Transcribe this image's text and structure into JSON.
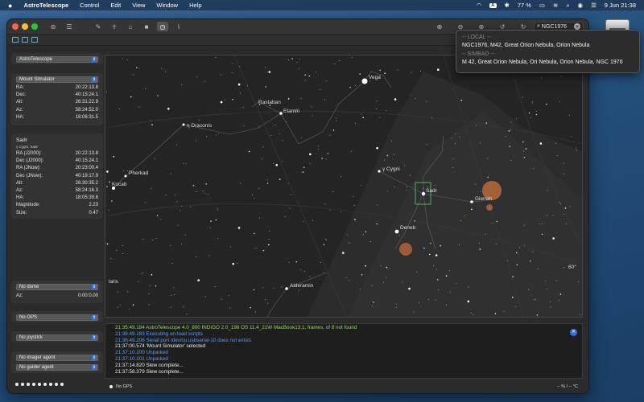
{
  "menubar": {
    "app_name": "AstroTelescope",
    "menus": [
      "Control",
      "Edit",
      "View",
      "Window",
      "Help"
    ],
    "input_badge": "A",
    "battery": "77 %",
    "datetime": "9 Jun  21:38"
  },
  "toolbar": {
    "search_value": "NGC1976"
  },
  "search_popup": {
    "local_header": "-- LOCAL --",
    "local_result": "NGC1976, M42, Great Orion Nebula, Orion Nebula",
    "simbad_header": "-- SIMBAD --",
    "simbad_result": "M  42, Great Orion Nebula, Ori Nebula, Orion Nebula, NGC  1976"
  },
  "sidebar": {
    "app_select": "AstroTelescope",
    "mount_select": "Mount Simulator",
    "mount": [
      {
        "k": "RA:",
        "v": "20:22:13.8"
      },
      {
        "k": "Dec:",
        "v": "40:15:24.1"
      },
      {
        "k": "Alt:",
        "v": "26:31:22.9"
      },
      {
        "k": "Az:",
        "v": "58:24:52.0"
      },
      {
        "k": "HA:",
        "v": "18:06:31.5"
      }
    ],
    "object_name": "Sadr",
    "object_sub": "γ Cygni, Sadr",
    "object": [
      {
        "k": "RA (J2000):",
        "v": "20:22:13.8"
      },
      {
        "k": "Dec (J2000):",
        "v": "40:15:24.1"
      },
      {
        "k": "RA (JNow):",
        "v": "20:23:00.4"
      },
      {
        "k": "Dec (JNow):",
        "v": "40:19:17.9"
      },
      {
        "k": "Alt:",
        "v": "26:30:35.2"
      },
      {
        "k": "Az:",
        "v": "58:24:16.3"
      },
      {
        "k": "HA:",
        "v": "18:05:39.8"
      },
      {
        "k": "Magnitude:",
        "v": "2.23"
      },
      {
        "k": "Size:",
        "v": "0.47"
      }
    ],
    "dome_select": "No dome",
    "dome_az_label": "Az:",
    "dome_az_value": "0:00:0.00",
    "gps_select": "No GPS",
    "joystick_select": "No joystick",
    "imager_select": "No imager agent",
    "guider_select": "No guider agent"
  },
  "skymap": {
    "labels": [
      "Vega",
      "Rastaban",
      "Etamin",
      "η Draconis",
      "Pherkad",
      "Kocab",
      "γ Cygni",
      "Sadr",
      "Gienah",
      "Deneb",
      "Alderamin",
      "60°",
      "laris"
    ]
  },
  "log": {
    "lines": [
      {
        "t": "21:35:49.184 AstroTelescope 4.0_800 INDIGO 2.0_198 OS 11.4_21W MacBook13,1, frames, of 8 not found",
        "c": "green"
      },
      {
        "t": "21:36:49.183 Executing on-load scripts",
        "c": "blue"
      },
      {
        "t": "21:36:49.208 Serial port /dev/cu.usbserial-10 does not exists",
        "c": "blue"
      },
      {
        "t": "21:37:00.574 'Mount Simulator' selected",
        "c": "white"
      },
      {
        "t": "21:37:10.200 Unparked",
        "c": "blue"
      },
      {
        "t": "21:37:10.201 Unparked",
        "c": "blue"
      },
      {
        "t": "21:37:14.820 Slew complete...",
        "c": "white"
      },
      {
        "t": "21:37:58.379 Slew complete...",
        "c": "white"
      }
    ]
  },
  "statusbar": {
    "gps": "No GPS",
    "right": "-- % / -- °C"
  }
}
